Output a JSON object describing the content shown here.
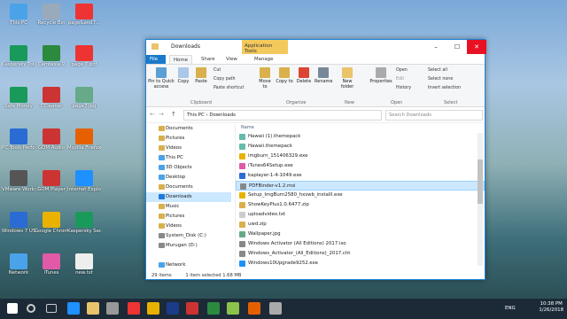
{
  "desktop": {
    "icons": [
      {
        "label": "This PC",
        "color": "#4aa3e8"
      },
      {
        "label": "Recycle Bin",
        "color": "#9ab"
      },
      {
        "label": "page&and7...",
        "color": "#e33"
      },
      {
        "label": "Kaspersky Total Security",
        "color": "#1a9a5a"
      },
      {
        "label": "Camtasia 9",
        "color": "#2b8a3e"
      },
      {
        "label": "page 7.pdf",
        "color": "#e33"
      },
      {
        "label": "Safe Money",
        "color": "#1a9a5a"
      },
      {
        "label": "CCleaner",
        "color": "#c33"
      },
      {
        "label": "page7.jpg",
        "color": "#6a8"
      },
      {
        "label": "PC Tools Performa...",
        "color": "#2a6bd4"
      },
      {
        "label": "GOM Audio",
        "color": "#c33"
      },
      {
        "label": "Mozilla Firefox",
        "color": "#e66000"
      },
      {
        "label": "VMware Workstati...",
        "color": "#555"
      },
      {
        "label": "GOM Player",
        "color": "#c33"
      },
      {
        "label": "Internet Explorer",
        "color": "#1e90ff"
      },
      {
        "label": "Windows 7 USB DVD...",
        "color": "#2a6bd4"
      },
      {
        "label": "Google Chrome",
        "color": "#e9b200"
      },
      {
        "label": "Kaspersky Secure C...",
        "color": "#1a9a5a"
      },
      {
        "label": "Network",
        "color": "#4aa3e8"
      },
      {
        "label": "iTunes",
        "color": "#e05aa8"
      },
      {
        "label": "new.txt",
        "color": "#eee"
      }
    ]
  },
  "window": {
    "title": "Downloads",
    "app_tools": "Application Tools",
    "min": "–",
    "max": "☐",
    "close": "✕"
  },
  "ribbon": {
    "tabs": [
      "File",
      "Home",
      "Share",
      "View",
      "Manage"
    ],
    "clipboard": {
      "pin": "Pin to Quick access",
      "copy": "Copy",
      "paste": "Paste",
      "cut": "Cut",
      "copy_path": "Copy path",
      "paste_shortcut": "Paste shortcut",
      "group": "Clipboard"
    },
    "organize": {
      "move": "Move to",
      "copy": "Copy to",
      "delete": "Delete",
      "rename": "Rename",
      "group": "Organize"
    },
    "new": {
      "folder": "New folder",
      "group": "New"
    },
    "open": {
      "properties": "Properties",
      "open": "Open",
      "edit": "Edit",
      "history": "History",
      "group": "Open"
    },
    "select": {
      "all": "Select all",
      "none": "Select none",
      "invert": "Invert selection",
      "group": "Select"
    }
  },
  "address": {
    "path": "This PC  ›  Downloads",
    "search_placeholder": "Search Downloads"
  },
  "nav": [
    {
      "label": "Documents",
      "color": "#d9b04c"
    },
    {
      "label": "Pictures",
      "color": "#d9b04c"
    },
    {
      "label": "Videos",
      "color": "#d9b04c"
    },
    {
      "label": "This PC",
      "color": "#4aa3e8"
    },
    {
      "label": "3D Objects",
      "color": "#4aa3e8"
    },
    {
      "label": "Desktop",
      "color": "#4aa3e8"
    },
    {
      "label": "Documents",
      "color": "#d9b04c"
    },
    {
      "label": "Downloads",
      "color": "#1e7ad9"
    },
    {
      "label": "Music",
      "color": "#d9b04c"
    },
    {
      "label": "Pictures",
      "color": "#d9b04c"
    },
    {
      "label": "Videos",
      "color": "#d9b04c"
    },
    {
      "label": "System_Disk (C:)",
      "color": "#888"
    },
    {
      "label": "Murugan (D:)",
      "color": "#888"
    },
    {
      "label": "",
      "color": "#fff"
    },
    {
      "label": "Network",
      "color": "#4aa3e8"
    }
  ],
  "file_list": {
    "column": "Name",
    "files": [
      {
        "name": "Hawaii (1).themepack",
        "color": "#6ba"
      },
      {
        "name": "Hawaii.themepack",
        "color": "#6ba"
      },
      {
        "name": "imgburn_151406329.exe",
        "color": "#e9b200"
      },
      {
        "name": "iTunes64Setup.exe",
        "color": "#e05aa8"
      },
      {
        "name": "kaplayer-1-4-1049.exe",
        "color": "#2a6bd4"
      },
      {
        "name": "PDFBinder-v1.2.msi",
        "color": "#888"
      },
      {
        "name": "Setup_ImgBurn2580_hxswb_installl.exe",
        "color": "#e9b200"
      },
      {
        "name": "ShowKeyPlus1.0.6477.zip",
        "color": "#d9b04c"
      },
      {
        "name": "uploadvideo.txt",
        "color": "#ccc"
      },
      {
        "name": "uwd.zip",
        "color": "#d9b04c"
      },
      {
        "name": "Wallpaper.jpg",
        "color": "#6a8"
      },
      {
        "name": "Windows Activator (All Editions) 2017.iso",
        "color": "#888"
      },
      {
        "name": "Windows_Activator_(All_Editions)_2017.cht",
        "color": "#888"
      },
      {
        "name": "Windows10Upgrade9252.exe",
        "color": "#1e90ff"
      }
    ]
  },
  "status": {
    "items": "29 items",
    "selected": "1 item selected  1.68 MB"
  },
  "taskbar": {
    "time": "10:38 PM",
    "date": "1/26/2018",
    "lang": "ENG"
  }
}
